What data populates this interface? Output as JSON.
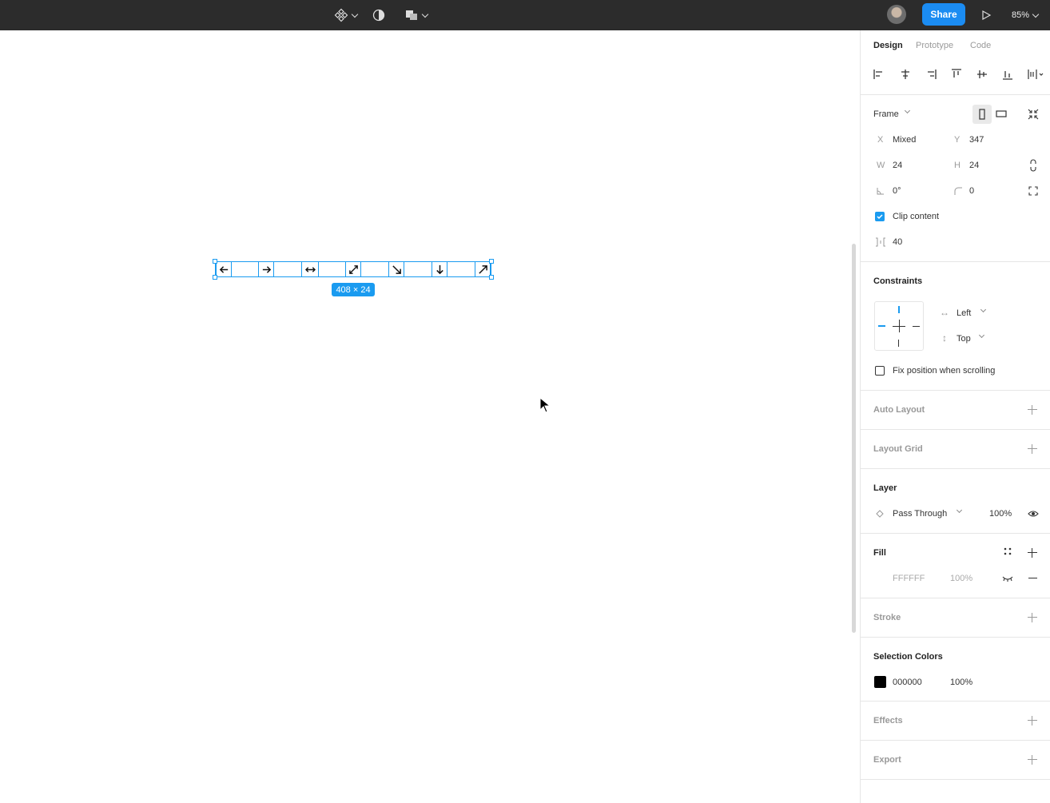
{
  "topbar": {
    "component_icon": "component-icon",
    "mask_icon": "contrast-icon",
    "boolean_icon": "boolean-ops-icon",
    "share_label": "Share",
    "zoom_label": "85%"
  },
  "canvas": {
    "dimension_label": "408 × 24",
    "frame_icons": [
      "arrow-left-icon",
      "arrow-right-icon",
      "arrows-horizontal-icon",
      "expand-diagonal-icon",
      "arrow-down-right-icon",
      "arrow-down-icon",
      "arrow-up-right-icon"
    ]
  },
  "panel": {
    "tabs": [
      "Design",
      "Prototype",
      "Code"
    ],
    "frame": {
      "label": "Frame",
      "x_label": "X",
      "x_value": "Mixed",
      "y_label": "Y",
      "y_value": "347",
      "w_label": "W",
      "w_value": "24",
      "h_label": "H",
      "h_value": "24",
      "rotation_value": "0°",
      "radius_value": "0",
      "clip_content_label": "Clip content",
      "spacing_value": "40"
    },
    "constraints": {
      "title": "Constraints",
      "horizontal": "Left",
      "vertical": "Top",
      "fix_position_label": "Fix position when scrolling"
    },
    "auto_layout": {
      "title": "Auto Layout"
    },
    "layout_grid": {
      "title": "Layout Grid"
    },
    "layer": {
      "title": "Layer",
      "blend": "Pass Through",
      "opacity": "100%"
    },
    "fill": {
      "title": "Fill",
      "hex": "FFFFFF",
      "opacity": "100%"
    },
    "stroke": {
      "title": "Stroke"
    },
    "selection_colors": {
      "title": "Selection Colors",
      "hex": "000000",
      "opacity": "100%",
      "swatch": "#000000"
    },
    "effects": {
      "title": "Effects"
    },
    "export": {
      "title": "Export"
    }
  },
  "colors": {
    "accent": "#1a9bf0",
    "share": "#1b8cf2",
    "topbar": "#2c2c2c"
  }
}
